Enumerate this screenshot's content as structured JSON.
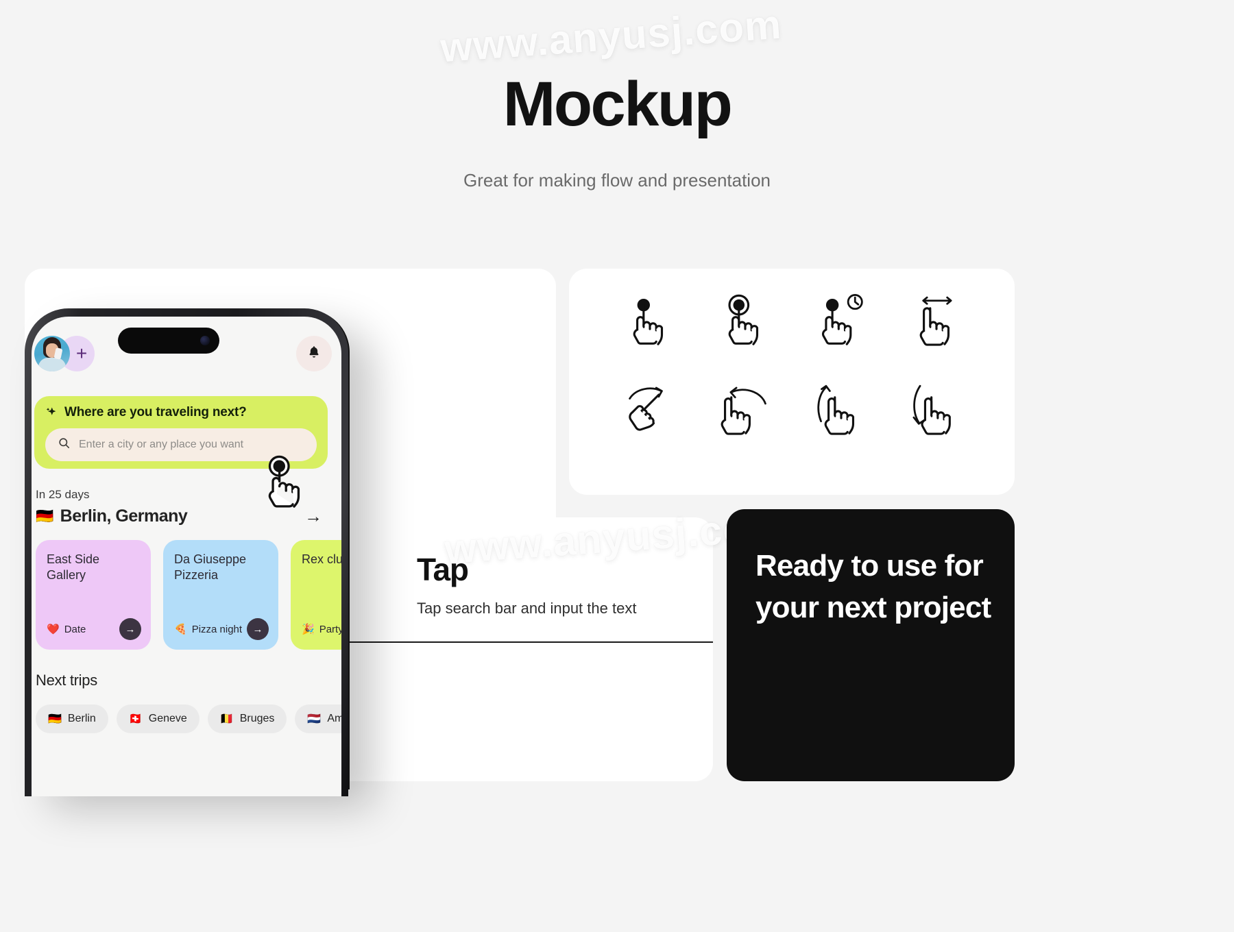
{
  "watermarks": {
    "top": "www.anyusj.com",
    "middle": "www.anyusj.com"
  },
  "header": {
    "title": "Mockup",
    "subtitle": "Great for making flow and presentation"
  },
  "tap_section": {
    "heading": "Tap",
    "description": "Tap search bar and input the text"
  },
  "ready_card": {
    "text": "Ready to use for your next project",
    "background": "#101010",
    "text_color": "#ffffff"
  },
  "gestures": {
    "items": [
      {
        "name": "tap-gesture-icon",
        "label": "Tap"
      },
      {
        "name": "double-tap-gesture-icon",
        "label": "Double tap"
      },
      {
        "name": "long-press-gesture-icon",
        "label": "Long press"
      },
      {
        "name": "swipe-horizontal-gesture-icon",
        "label": "Swipe horizontal"
      },
      {
        "name": "swipe-right-gesture-icon",
        "label": "Swipe right"
      },
      {
        "name": "swipe-left-gesture-icon",
        "label": "Swipe left"
      },
      {
        "name": "swipe-up-gesture-icon",
        "label": "Swipe up"
      },
      {
        "name": "swipe-down-gesture-icon",
        "label": "Swipe down"
      }
    ]
  },
  "phone": {
    "topbar": {
      "avatar_icon": "user-avatar",
      "add_label": "+",
      "notification_icon": "bell-icon"
    },
    "search_card": {
      "title": "Where are you traveling next?",
      "sparkle_icon": "sparkle-icon",
      "search_icon": "search-icon",
      "placeholder": "Enter a city or any place you want",
      "input_value": "",
      "background": "#d8ef62",
      "field_background": "#f7ede4"
    },
    "trip": {
      "when": "In 25 days",
      "flag": "🇩🇪",
      "city": "Berlin, Germany",
      "arrow": "→"
    },
    "places": [
      {
        "name": "East Side Gallery",
        "tag_emoji": "❤️",
        "tag": "Date",
        "color": "#eec8f7",
        "go": "→"
      },
      {
        "name": "Da Giuseppe Pizzeria",
        "tag_emoji": "🍕",
        "tag": "Pizza night",
        "color": "#b3ddf9",
        "go": "→"
      },
      {
        "name": "Rex club Disco",
        "tag_emoji": "🎉",
        "tag": "Party",
        "color": "#ddf56c",
        "go": "→"
      }
    ],
    "next_trips": {
      "title": "Next trips",
      "chips": [
        {
          "flag": "🇩🇪",
          "label": "Berlin"
        },
        {
          "flag": "🇨🇭",
          "label": "Geneve"
        },
        {
          "flag": "🇧🇪",
          "label": "Bruges"
        },
        {
          "flag": "🇳🇱",
          "label": "Amsterdam"
        }
      ]
    },
    "cursor_icon": "tap-hand-cursor"
  }
}
